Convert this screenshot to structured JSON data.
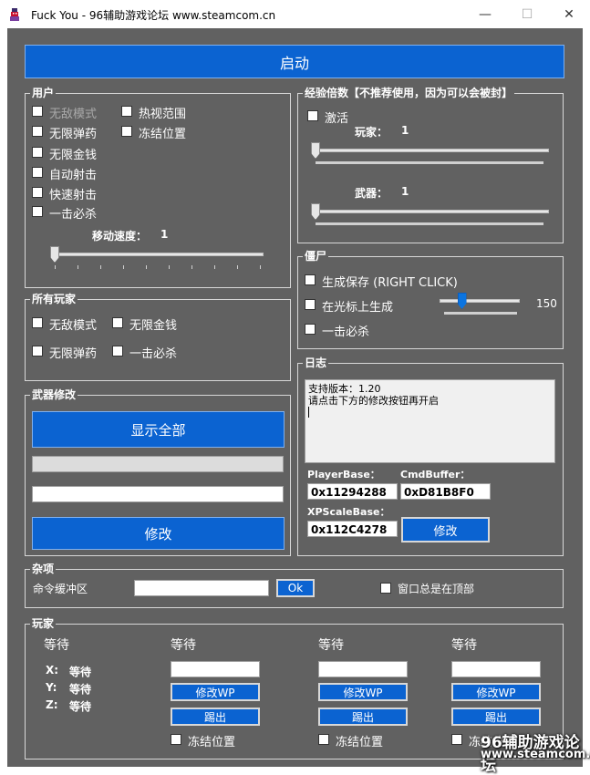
{
  "window": {
    "title": "Fuck You - 96辅助游戏论坛 www.steamcom.cn",
    "minimize": "—",
    "maximize": "☐",
    "close": "✕"
  },
  "start_button": "启动",
  "user": {
    "title": "用户",
    "god_mode": "无敌模式",
    "thermal_view": "热视范围",
    "infinite_ammo": "无限弹药",
    "freeze_position": "冻结位置",
    "infinite_money": "无限金钱",
    "auto_shoot": "自动射击",
    "rapid_fire": "快速射击",
    "one_hit_kill": "一击必杀",
    "move_speed_label": "移动速度：",
    "move_speed_value": "1"
  },
  "exp": {
    "title": "经验倍数【不推荐使用，因为可以会被封】",
    "activate": "激活",
    "player_label": "玩家：",
    "player_value": "1",
    "weapon_label": "武器：",
    "weapon_value": "1"
  },
  "all_players": {
    "title": "所有玩家",
    "god_mode": "无敌模式",
    "infinite_money": "无限金钱",
    "infinite_ammo": "无限弹药",
    "one_hit_kill": "一击必杀"
  },
  "zombie": {
    "title": "僵尸",
    "spawn_save": "生成保存 (RIGHT CLICK)",
    "spawn_at_cursor": "在光标上生成",
    "spawn_count": "150",
    "spawn_level": 0.25,
    "one_hit_kill": "一击必杀"
  },
  "weapon_mod": {
    "title": "武器修改",
    "show_all": "显示全部",
    "modify": "修改"
  },
  "log": {
    "title": "日志",
    "lines": [
      "支持版本：1.20",
      "请点击下方的修改按钮再开启"
    ],
    "player_base_label": "PlayerBase：",
    "player_base_value": "0x11294288",
    "cmd_buffer_label": "CmdBuffer：",
    "cmd_buffer_value": "0xD81B8F0",
    "xp_scale_label": "XPScaleBase：",
    "xp_scale_value": "0x112C4278",
    "modify": "修改"
  },
  "misc": {
    "title": "杂项",
    "cmd_buffer_label": "命令缓冲区",
    "ok": "Ok",
    "always_on_top": "窗口总是在顶部"
  },
  "players": {
    "title": "玩家",
    "waiting": "等待",
    "x_label": "X:",
    "y_label": "Y:",
    "z_label": "Z:",
    "x_value": "等待",
    "y_value": "等待",
    "z_value": "等待",
    "columns": [
      {
        "name": "等待",
        "modify_wp": "修改WP",
        "kick": "踢出",
        "freeze": "冻结位置"
      },
      {
        "name": "等待",
        "modify_wp": "修改WP",
        "kick": "踢出",
        "freeze": "冻结位置"
      },
      {
        "name": "等待",
        "modify_wp": "修改WP",
        "kick": "踢出",
        "freeze": "冻结位置"
      }
    ]
  },
  "watermark": {
    "line1": "96辅助游戏论坛",
    "line2": "www.steamcom.cn"
  }
}
